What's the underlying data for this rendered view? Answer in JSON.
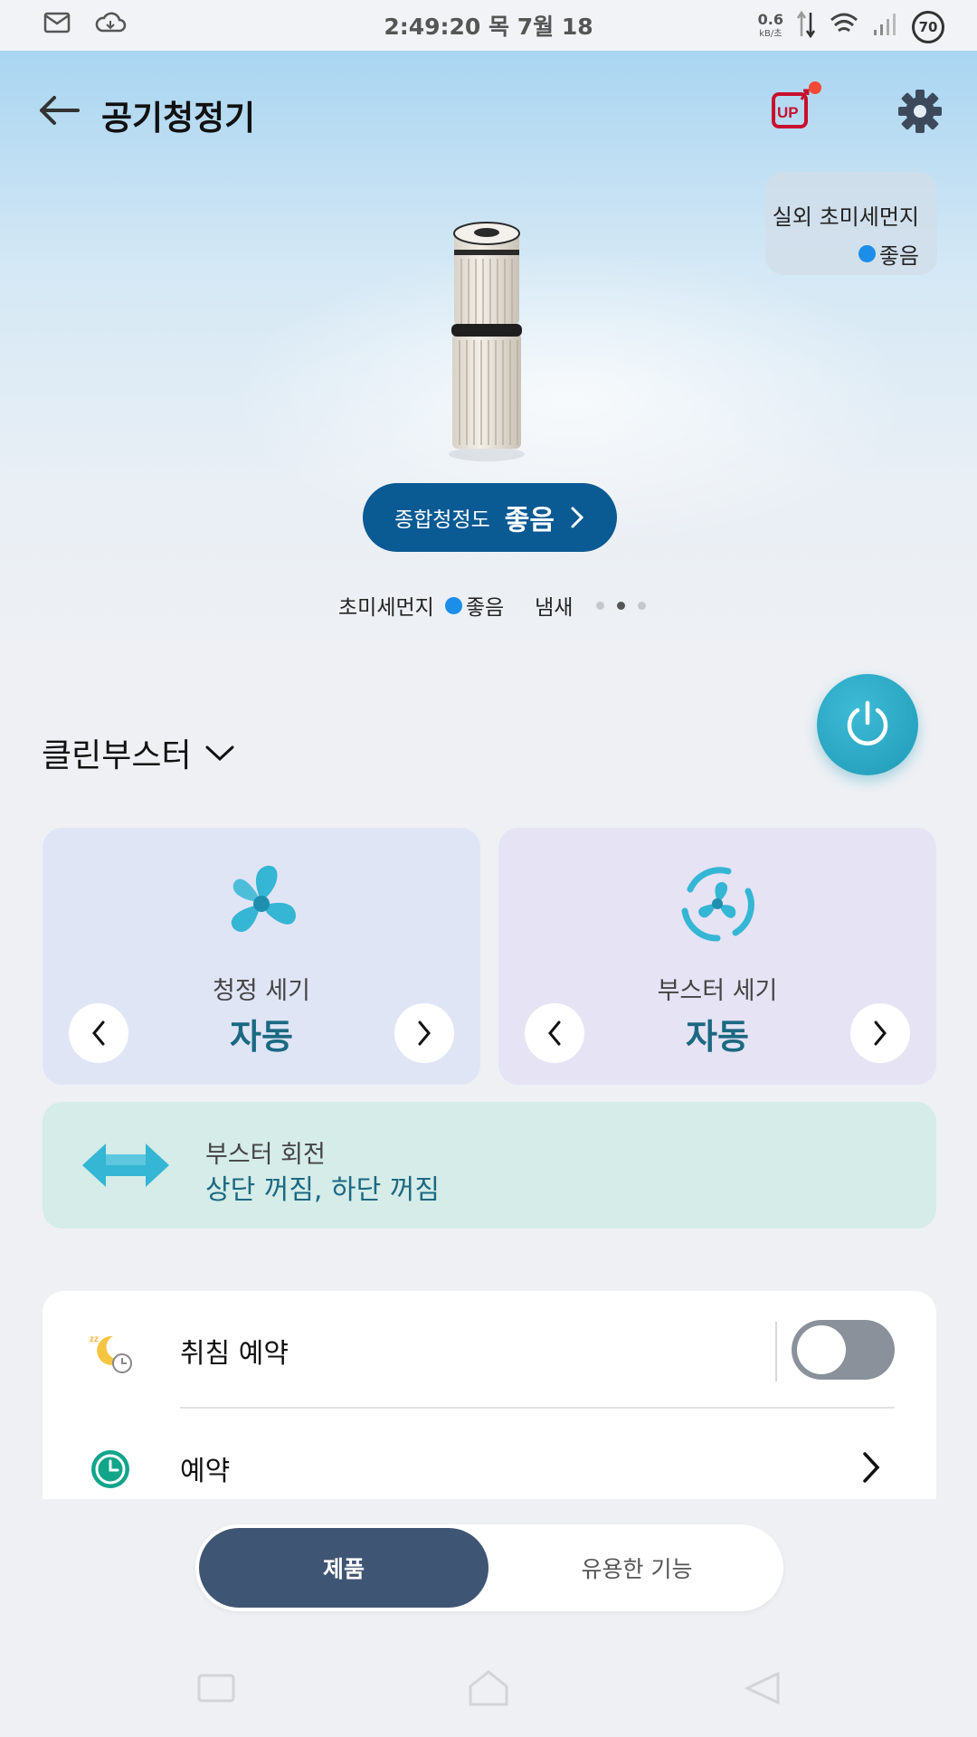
{
  "status_bar": {
    "time": "2:49:20 목 7월 18",
    "net_speed": "0.6",
    "net_unit": "kB/초",
    "battery": "70"
  },
  "header": {
    "title": "공기청정기",
    "up_badge": "UP"
  },
  "outdoor": {
    "label": "실외 초미세먼지",
    "status": "좋음",
    "status_color": "#1c8de8"
  },
  "overall": {
    "label": "종합청정도",
    "value": "좋음"
  },
  "sensors": {
    "fine_dust_label": "초미세먼지",
    "fine_dust_value": "좋음",
    "smell_label": "냄새"
  },
  "mode": {
    "selected": "클린부스터"
  },
  "cards": {
    "clean_strength": {
      "label": "청정 세기",
      "value": "자동"
    },
    "booster_strength": {
      "label": "부스터 세기",
      "value": "자동"
    }
  },
  "rotation": {
    "label": "부스터 회전",
    "value": "상단 꺼짐, 하단 꺼짐"
  },
  "settings": {
    "sleep_reservation": {
      "label": "취침 예약",
      "enabled": false
    },
    "reservation": {
      "label": "예약"
    }
  },
  "bottom_tabs": {
    "product": "제품",
    "useful": "유용한 기능"
  },
  "colors": {
    "accent_dark": "#0a5a94",
    "teal_text": "#1b6982",
    "power": "#1f9bb8",
    "tab_active": "#3f5574"
  }
}
